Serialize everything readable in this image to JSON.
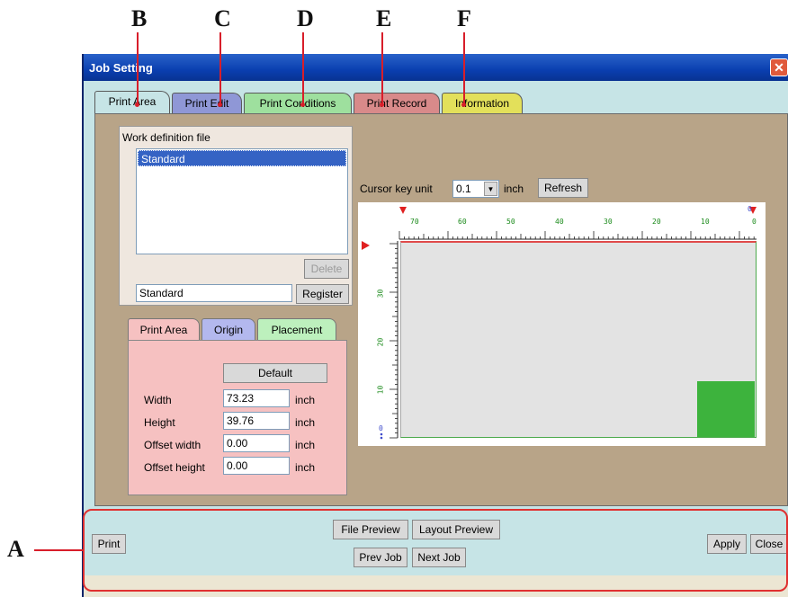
{
  "callouts": [
    "B",
    "C",
    "D",
    "E",
    "F",
    "A"
  ],
  "window": {
    "title": "Job Setting",
    "close_glyph": "✕"
  },
  "tabs": [
    {
      "label": "Print Area",
      "color": "#c6e4e6"
    },
    {
      "label": "Print Edit",
      "color": "#8f97d6"
    },
    {
      "label": "Print Conditions",
      "color": "#9ee09e"
    },
    {
      "label": "Print Record",
      "color": "#d88a8a"
    },
    {
      "label": "Information",
      "color": "#e3e05a"
    }
  ],
  "work_definition": {
    "label": "Work definition file",
    "items": [
      "Standard"
    ],
    "delete_label": "Delete",
    "name_value": "Standard",
    "register_label": "Register"
  },
  "subtabs": [
    {
      "label": "Print Area",
      "color": "#f6c1c1"
    },
    {
      "label": "Origin",
      "color": "#b3b8ee"
    },
    {
      "label": "Placement",
      "color": "#bdf0bd"
    }
  ],
  "print_area": {
    "default_label": "Default",
    "fields": [
      {
        "label": "Width",
        "value": "73.23",
        "unit": "inch"
      },
      {
        "label": "Height",
        "value": "39.76",
        "unit": "inch"
      },
      {
        "label": "Offset width",
        "value": "0.00",
        "unit": "inch"
      },
      {
        "label": "Offset height",
        "value": "0.00",
        "unit": "inch"
      }
    ]
  },
  "cursor": {
    "label": "Cursor key unit",
    "value": "0.1",
    "unit": "inch",
    "refresh_label": "Refresh"
  },
  "ruler": {
    "top_ticks": [
      "70",
      "60",
      "50",
      "40",
      "30",
      "20",
      "10",
      "0"
    ],
    "left_ticks": [
      "30",
      "20",
      "10",
      "0"
    ]
  },
  "bottom": {
    "print_label": "Print",
    "file_preview_label": "File Preview",
    "layout_preview_label": "Layout Preview",
    "prev_job_label": "Prev Job",
    "next_job_label": "Next Job",
    "apply_label": "Apply",
    "close_label": "Close"
  }
}
